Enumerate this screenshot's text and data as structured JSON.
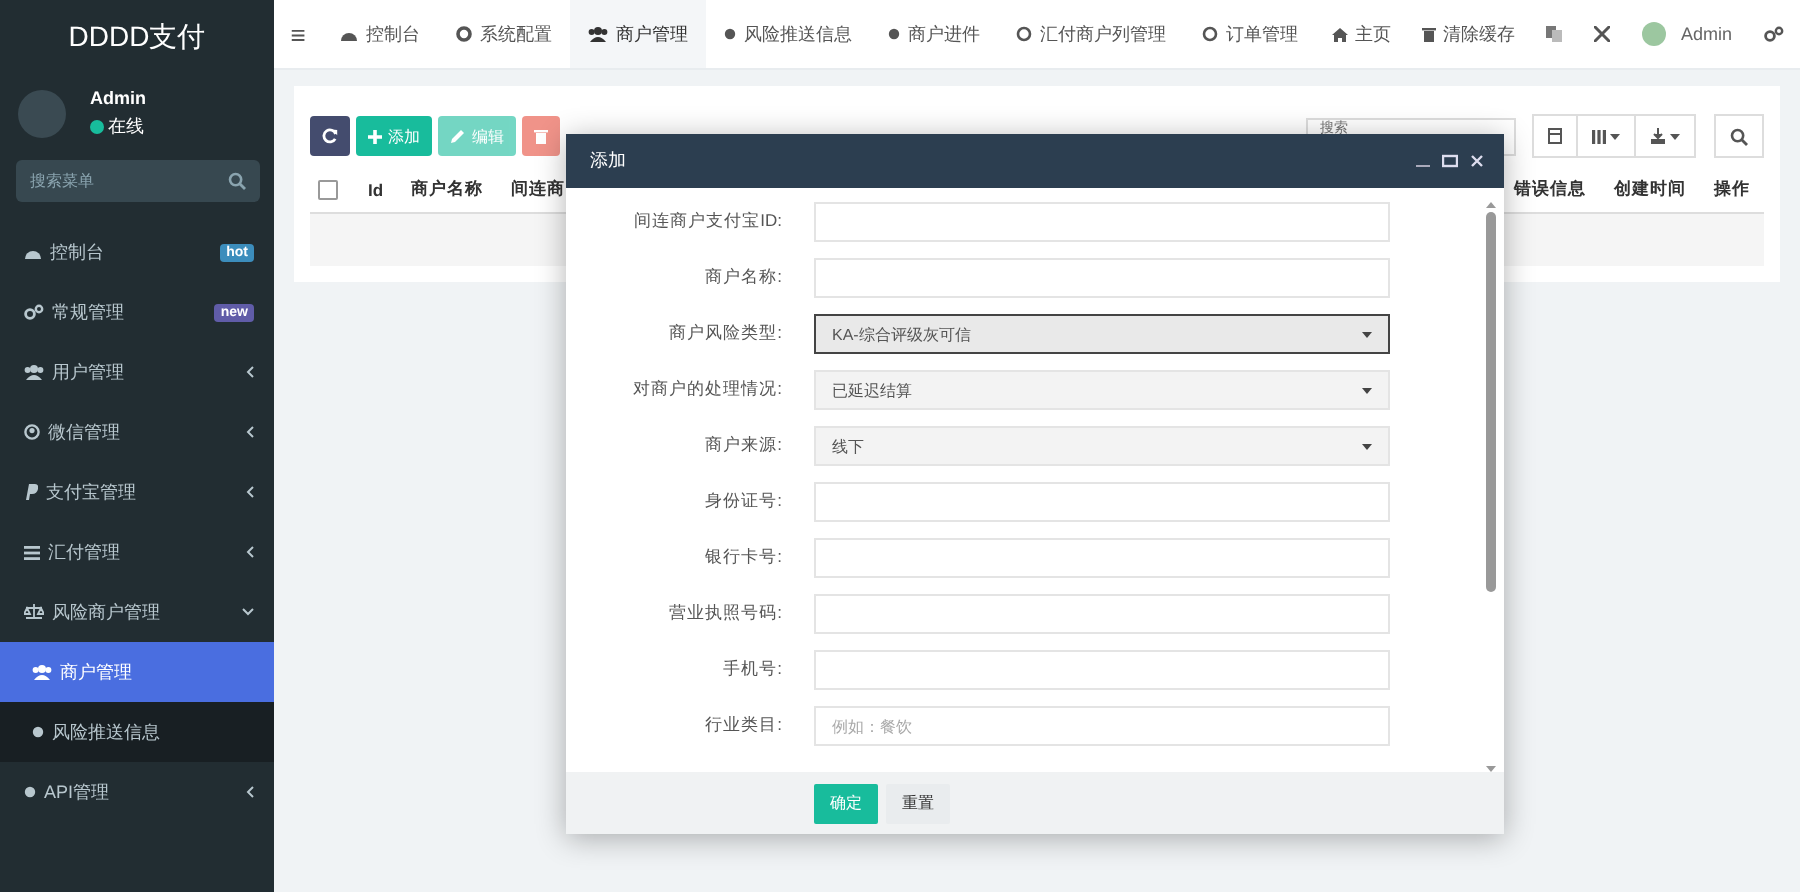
{
  "sidebar": {
    "logo": "DDDD支付",
    "user": {
      "name": "Admin",
      "status": "在线"
    },
    "search": {
      "placeholder": "搜索菜单"
    },
    "items": [
      {
        "label": "控制台",
        "selected": false,
        "badge": {
          "text": "hot",
          "color": "#3c8dbc"
        }
      },
      {
        "label": "常规管理",
        "selected": false,
        "badge": {
          "text": "new",
          "color": "#605ca8"
        }
      },
      {
        "label": "用户管理",
        "selected": false,
        "expanded": false
      },
      {
        "label": "微信管理",
        "selected": false,
        "expanded": false
      },
      {
        "label": "支付宝管理",
        "selected": false,
        "expanded": false
      },
      {
        "label": "汇付管理",
        "selected": false,
        "expanded": false
      },
      {
        "label": "风险商户管理",
        "selected": false,
        "expanded": true,
        "children": [
          {
            "label": "商户管理",
            "selected": true
          },
          {
            "label": "风险推送信息",
            "selected": false
          }
        ]
      },
      {
        "label": "API管理",
        "selected": false,
        "expanded": false
      }
    ]
  },
  "topnav": {
    "menu": "≡",
    "tabs": [
      {
        "label": "控制台",
        "selected": false
      },
      {
        "label": "系统配置",
        "selected": false
      },
      {
        "label": "商户管理",
        "selected": true
      },
      {
        "label": "风险推送信息",
        "selected": false
      },
      {
        "label": "商户进件",
        "selected": false
      },
      {
        "label": "汇付商户列管理",
        "selected": false
      },
      {
        "label": "订单管理",
        "selected": false
      }
    ],
    "links": [
      {
        "label": "主页"
      },
      {
        "label": "清除缓存"
      }
    ],
    "user": "Admin"
  },
  "toolbar": {
    "buttons": [
      {
        "kind": "refresh",
        "disabled": false
      },
      {
        "kind": "add",
        "label": "添加",
        "disabled": false
      },
      {
        "kind": "edit",
        "label": "编辑",
        "disabled": true
      },
      {
        "kind": "delete",
        "disabled": true
      }
    ],
    "search": {
      "placeholder": "搜索"
    }
  },
  "table": {
    "select_all_checked": false,
    "columns_left": [
      "Id",
      "商户名称",
      "间连商"
    ],
    "columns_right": [
      "错误信息",
      "创建时间",
      "操作"
    ]
  },
  "modal": {
    "title": "添加",
    "fields": [
      {
        "label": "间连商户支付宝ID:",
        "kind": "text"
      },
      {
        "label": "商户名称:",
        "kind": "text"
      },
      {
        "label": "商户风险类型:",
        "kind": "select",
        "value": "KA-综合评级灰可信",
        "focused": true
      },
      {
        "label": "对商户的处理情况:",
        "kind": "select",
        "value": "已延迟结算",
        "focused": false
      },
      {
        "label": "商户来源:",
        "kind": "select",
        "value": "线下",
        "focused": false
      },
      {
        "label": "身份证号:",
        "kind": "text"
      },
      {
        "label": "银行卡号:",
        "kind": "text"
      },
      {
        "label": "营业执照号码:",
        "kind": "text"
      },
      {
        "label": "手机号:",
        "kind": "text"
      },
      {
        "label": "行业类目:",
        "kind": "text",
        "placeholder": "例如：餐饮"
      }
    ],
    "buttons": [
      {
        "label": "确定",
        "primary": true
      },
      {
        "label": "重置",
        "primary": false
      }
    ]
  }
}
